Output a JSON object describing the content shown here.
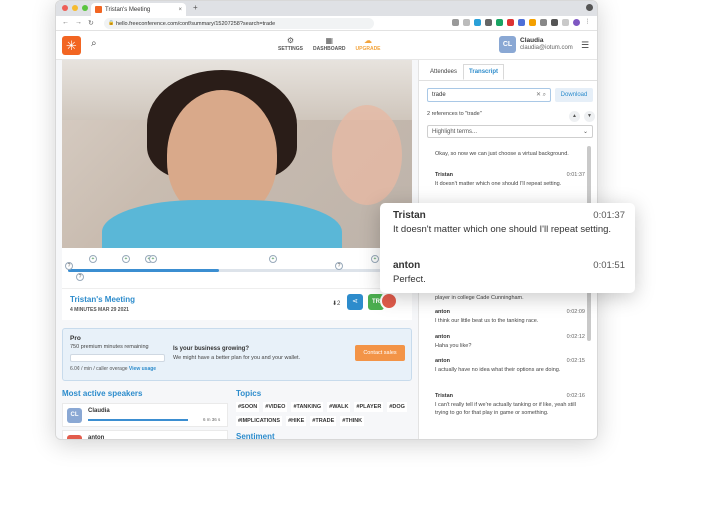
{
  "browser": {
    "tab_title": "Tristan's Meeting",
    "tab_close": "×",
    "new_tab": "+",
    "url": "hello.freeconference.com/conf/summary/15207258?search=trade"
  },
  "header": {
    "nav": [
      {
        "label": "SETTINGS",
        "icon": "gear-icon"
      },
      {
        "label": "DASHBOARD",
        "icon": "calendar-icon"
      },
      {
        "label": "UPGRADE",
        "icon": "cloud-icon"
      }
    ],
    "user": {
      "initials": "CL",
      "name": "Claudia",
      "email": "claudia@iotum.com"
    }
  },
  "meeting": {
    "title": "Tristan's Meeting",
    "subtitle": "4 MINUTES   MAR 29 2021",
    "attendee_count": "⬇2",
    "tr_initials": "TR"
  },
  "pro": {
    "title": "Pro",
    "minutes": "750 premium minutes remaining",
    "rate": "6.0¢ / min / caller overage",
    "view_usage": "View usage",
    "question": "Is your business growing?",
    "question_sub": "We might have a better plan for you and your wallet.",
    "contact": "Contact sales"
  },
  "speakers": {
    "title": "Most active speakers",
    "items": [
      {
        "initials": "CL",
        "name": "Claudia",
        "time": "6 m 36 s",
        "color": "#8aa8d4"
      },
      {
        "initials": "",
        "name": "anton",
        "time": "",
        "color": "#e25c4c"
      }
    ]
  },
  "topics": {
    "title": "Topics",
    "items": [
      "#SOON",
      "#VIDEO",
      "#TANKING",
      "#WALK",
      "#PLAYER",
      "#DOG",
      "#IMPLICATIONS",
      "#HIKE",
      "#TRADE",
      "#THINK"
    ]
  },
  "sentiment": {
    "title": "Sentiment"
  },
  "transcript": {
    "tabs": [
      "Attendees",
      "Transcript"
    ],
    "search_value": "trade",
    "download": "Download",
    "refs": "2 references to \"trade\"",
    "highlight_placeholder": "Highlight terms...",
    "entries": [
      {
        "name": "",
        "time": "",
        "text": "Okay, so now we can just choose a virtual background."
      },
      {
        "name": "Tristan",
        "time": "0:01:37",
        "text": "It doesn't matter which one should I'll repeat setting."
      },
      {
        "name": "",
        "time": "",
        "text": "player in college Cade Cunningham."
      },
      {
        "name": "anton",
        "time": "0:02:09",
        "text": "I think our little beat us to the tanking race."
      },
      {
        "name": "anton",
        "time": "0:02:12",
        "text": "Haha you like?"
      },
      {
        "name": "anton",
        "time": "0:02:15",
        "text": "I actually have no idea what their options are doing."
      },
      {
        "name": "Tristan",
        "time": "0:02:16",
        "text": "I can't really tell if we're actually tanking or if like, yeah still trying to go for that play in game or something."
      }
    ]
  },
  "popup": {
    "entries": [
      {
        "name": "Tristan",
        "time": "0:01:37",
        "text": "It doesn't matter which one should I'll repeat setting."
      },
      {
        "name": "anton",
        "time": "0:01:51",
        "text": "Perfect."
      }
    ]
  },
  "colors": {
    "accent": "#2d8ccc",
    "brand": "#f26522",
    "upgrade": "#f2a33a",
    "cta": "#f39447"
  }
}
